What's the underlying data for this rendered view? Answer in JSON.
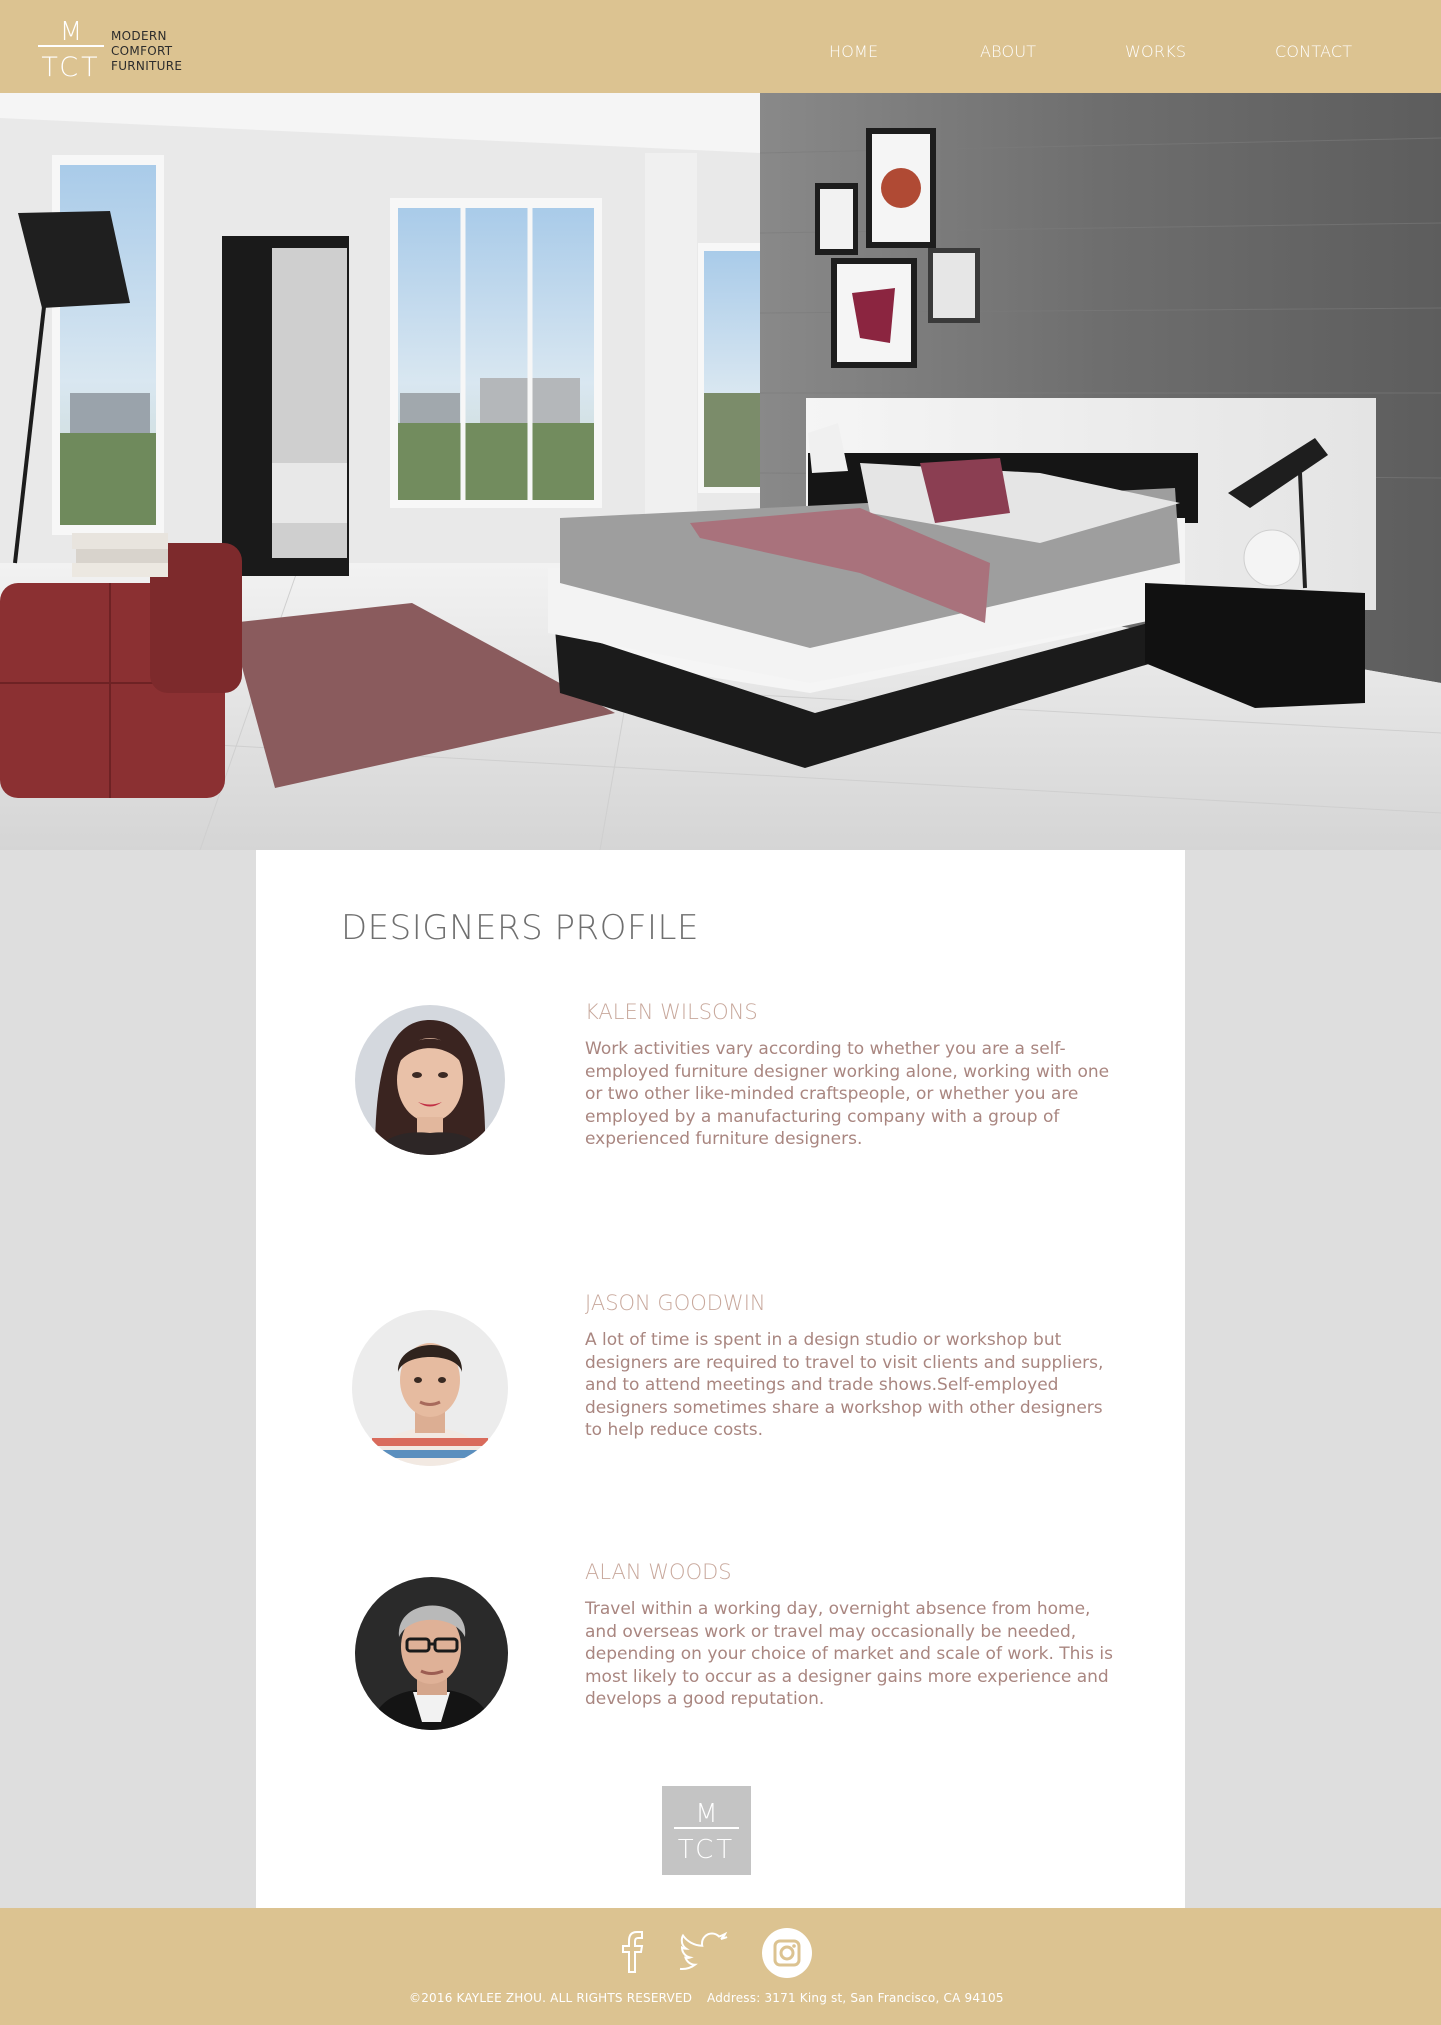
{
  "brand": {
    "mark_top": "M",
    "mark_bottom": "TCT",
    "lines": [
      "MODERN",
      "COMFORT",
      "FURNITURE"
    ]
  },
  "nav": {
    "items": [
      "HOME",
      "ABOUT",
      "WORKS",
      "CONTACT"
    ]
  },
  "content": {
    "title": "DESIGNERS PROFILE",
    "designers": [
      {
        "name": "KALEN WILSONS",
        "bio": "Work activities vary according to whether you are a self-employed furniture designer working alone, working with one or two other like-minded craftspeople, or whether you are employed by a manufacturing company with a group of experienced furniture designers."
      },
      {
        "name": "JASON GOODWIN",
        "bio": "A lot of time is spent in a design studio or workshop but designers are required to travel to visit clients and suppliers, and to attend meetings and trade shows.Self-employed designers sometimes share a workshop with other designers to help reduce costs."
      },
      {
        "name": "ALAN WOODS",
        "bio": "Travel within a working day, overnight absence from home, and overseas work or travel may occasionally be needed, depending on your choice of market and scale of work. This is most likely to occur as a designer gains more experience and develops a good reputation."
      }
    ]
  },
  "footer": {
    "social_icons": [
      "facebook-icon",
      "twitter-icon",
      "instagram-icon"
    ],
    "copyright": "©2016 KAYLEE ZHOU.  ALL RIGHTS RESERVED",
    "address": "Address: 3171 King st, San Francisco, CA 94105"
  },
  "colors": {
    "header_bg": "#dcc391",
    "page_bg": "#dedede",
    "name_color": "#c8a89c",
    "bio_color": "#a98680",
    "title_color": "#6f6f6f"
  }
}
